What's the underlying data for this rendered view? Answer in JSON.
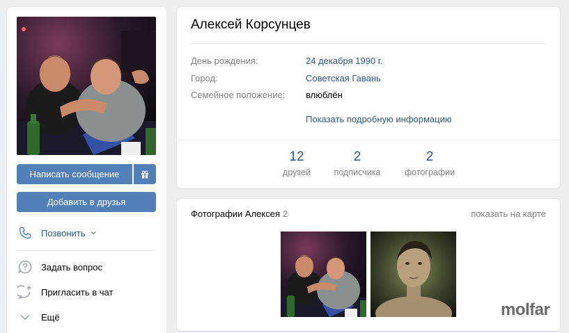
{
  "profile": {
    "name": "Алексей Корсунцев"
  },
  "actions": {
    "write_label": "Написать сообщение",
    "add_friend_label": "Добавить в друзья"
  },
  "menu": {
    "call": "Позвонить",
    "ask": "Задать вопрос",
    "invite": "Пригласить в чат",
    "more": "Ещё"
  },
  "info": {
    "birthday_label": "День рождения:",
    "birthday_value": "24 декабря 1990 г.",
    "city_label": "Город:",
    "city_value": "Советская Гавань",
    "status_label": "Семейное положение:",
    "status_value": "влюблён",
    "more_link": "Показать подробную информацию"
  },
  "counters": [
    {
      "value": "12",
      "label": "друзей"
    },
    {
      "value": "2",
      "label": "подписчика"
    },
    {
      "value": "2",
      "label": "фотографии"
    }
  ],
  "photos": {
    "title": "Фотографии Алексея",
    "count": "2",
    "map_link": "показать на карте"
  },
  "watermark": "molfar",
  "colors": {
    "accent": "#5181b8",
    "link": "#2a5885",
    "muted": "#828282",
    "background": "#edeef0"
  }
}
